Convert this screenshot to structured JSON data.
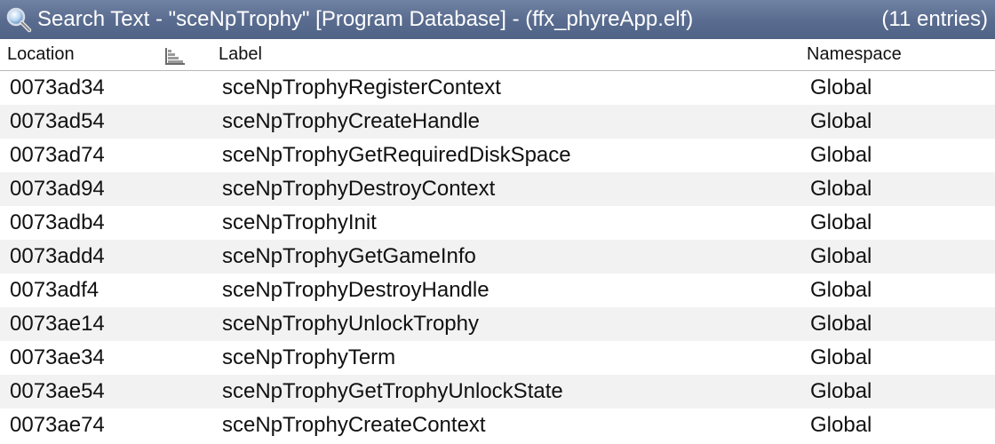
{
  "window": {
    "title": "Search Text - \"sceNpTrophy\"  [Program Database] - (ffx_phyreApp.elf)",
    "entry_count": "(11 entries)",
    "title_icon": "magnifier-icon"
  },
  "table": {
    "columns": {
      "location": "Location",
      "label": "Label",
      "namespace": "Namespace",
      "sort_icon": "sort-descending-icon"
    },
    "rows": [
      {
        "location": "0073ad34",
        "label": "sceNpTrophyRegisterContext",
        "namespace": "Global"
      },
      {
        "location": "0073ad54",
        "label": "sceNpTrophyCreateHandle",
        "namespace": "Global"
      },
      {
        "location": "0073ad74",
        "label": "sceNpTrophyGetRequiredDiskSpace",
        "namespace": "Global"
      },
      {
        "location": "0073ad94",
        "label": "sceNpTrophyDestroyContext",
        "namespace": "Global"
      },
      {
        "location": "0073adb4",
        "label": "sceNpTrophyInit",
        "namespace": "Global"
      },
      {
        "location": "0073add4",
        "label": "sceNpTrophyGetGameInfo",
        "namespace": "Global"
      },
      {
        "location": "0073adf4",
        "label": "sceNpTrophyDestroyHandle",
        "namespace": "Global"
      },
      {
        "location": "0073ae14",
        "label": "sceNpTrophyUnlockTrophy",
        "namespace": "Global"
      },
      {
        "location": "0073ae34",
        "label": "sceNpTrophyTerm",
        "namespace": "Global"
      },
      {
        "location": "0073ae54",
        "label": "sceNpTrophyGetTrophyUnlockState",
        "namespace": "Global"
      },
      {
        "location": "0073ae74",
        "label": "sceNpTrophyCreateContext",
        "namespace": "Global"
      }
    ]
  },
  "colors": {
    "titlebar": "#5a6d90",
    "row_alt": "#f2f2f2",
    "text": "#111111"
  }
}
